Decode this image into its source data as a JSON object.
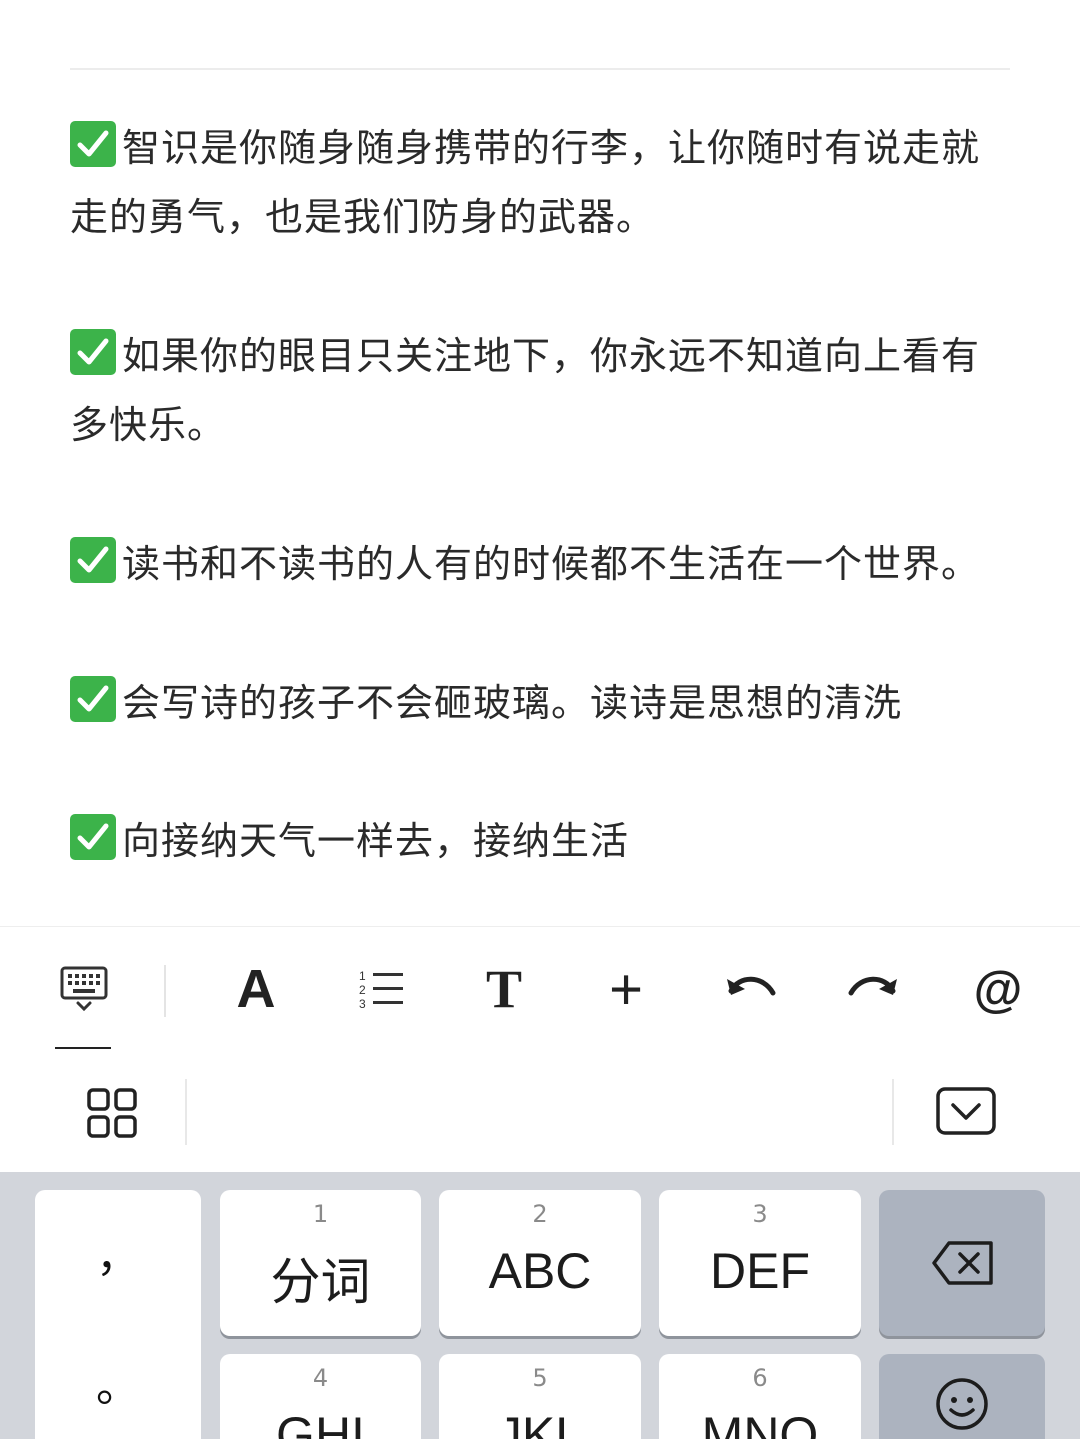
{
  "editor": {
    "partial_title": "",
    "paragraphs": [
      {
        "text": "智识是你随身随身携带的行李，让你随时有说走就走的勇气，也是我们防身的武器。"
      },
      {
        "text": "如果你的眼目只关注地下，你永远不知道向上看有多快乐。"
      },
      {
        "text": "读书和不读书的人有的时候都不生活在一个世界。"
      },
      {
        "text": "会写诗的孩子不会砸玻璃。读诗是思想的清洗"
      },
      {
        "text": "向接纳天气一样去，接纳生活"
      }
    ],
    "check_icon": "check-mark-button-emoji"
  },
  "toolbar": {
    "items": [
      {
        "icon": "keyboard-icon"
      },
      {
        "icon": "text-format-icon",
        "label": "A"
      },
      {
        "icon": "numbered-list-icon"
      },
      {
        "icon": "text-style-icon",
        "label": "T"
      },
      {
        "icon": "plus-icon",
        "label": "+"
      },
      {
        "icon": "undo-icon"
      },
      {
        "icon": "redo-icon"
      },
      {
        "icon": "mention-icon",
        "label": "@"
      }
    ]
  },
  "keyboard": {
    "punct": {
      "comma": "，",
      "period": "。"
    },
    "keys": [
      {
        "num": "1",
        "label": "分词"
      },
      {
        "num": "2",
        "label": "ABC"
      },
      {
        "num": "3",
        "label": "DEF"
      },
      {
        "num": "4",
        "label": "GHI"
      },
      {
        "num": "5",
        "label": "JKL"
      },
      {
        "num": "6",
        "label": "MNO"
      }
    ],
    "colors": {
      "background": "#d2d5db",
      "key": "#ffffff",
      "dark_key": "#acb3bf"
    }
  }
}
